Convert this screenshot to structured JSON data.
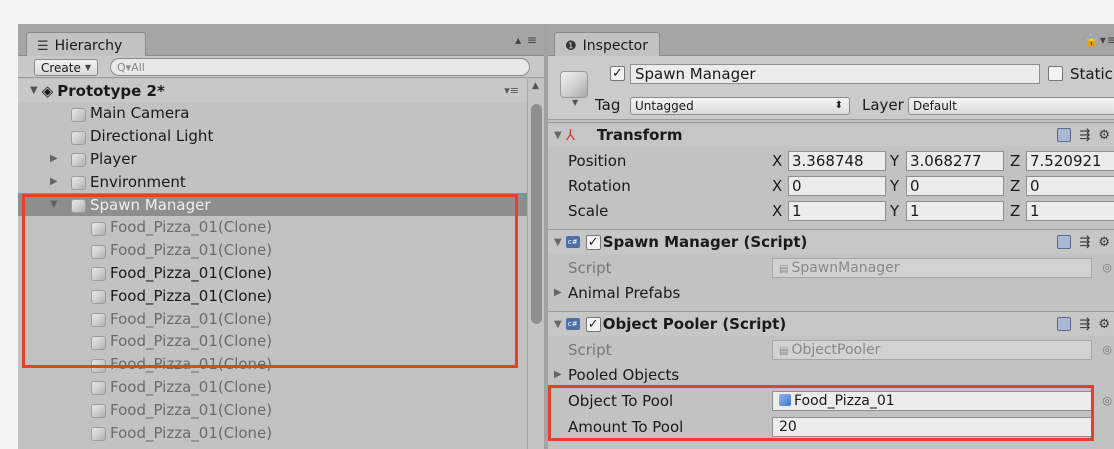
{
  "hierarchy": {
    "tab_label": "Hierarchy",
    "tab_icon": "list-icon",
    "tab_tools": "▴ ≡",
    "create_label": "Create",
    "search_placeholder": "Q▾All",
    "scene_name": "Prototype 2*",
    "items": [
      {
        "label": "Main Camera",
        "level": 1,
        "dim": false,
        "selected": false,
        "foldable": false
      },
      {
        "label": "Directional Light",
        "level": 1,
        "dim": false,
        "selected": false,
        "foldable": false
      },
      {
        "label": "Player",
        "level": 1,
        "dim": false,
        "selected": false,
        "foldable": true,
        "expanded": false
      },
      {
        "label": "Environment",
        "level": 1,
        "dim": false,
        "selected": false,
        "foldable": true,
        "expanded": false
      },
      {
        "label": "Spawn Manager",
        "level": 1,
        "dim": false,
        "selected": true,
        "foldable": true,
        "expanded": true
      },
      {
        "label": "Food_Pizza_01(Clone)",
        "level": 2,
        "dim": true,
        "selected": false
      },
      {
        "label": "Food_Pizza_01(Clone)",
        "level": 2,
        "dim": true,
        "selected": false
      },
      {
        "label": "Food_Pizza_01(Clone)",
        "level": 2,
        "dim": false,
        "selected": false
      },
      {
        "label": "Food_Pizza_01(Clone)",
        "level": 2,
        "dim": false,
        "selected": false
      },
      {
        "label": "Food_Pizza_01(Clone)",
        "level": 2,
        "dim": true,
        "selected": false
      },
      {
        "label": "Food_Pizza_01(Clone)",
        "level": 2,
        "dim": true,
        "selected": false
      },
      {
        "label": "Food_Pizza_01(Clone)",
        "level": 2,
        "dim": true,
        "selected": false
      },
      {
        "label": "Food_Pizza_01(Clone)",
        "level": 2,
        "dim": true,
        "selected": false
      },
      {
        "label": "Food_Pizza_01(Clone)",
        "level": 2,
        "dim": true,
        "selected": false
      },
      {
        "label": "Food_Pizza_01(Clone)",
        "level": 2,
        "dim": true,
        "selected": false
      }
    ]
  },
  "inspector": {
    "tab_label": "Inspector",
    "tab_icon": "info-icon",
    "object_name": "Spawn Manager",
    "static_label": "Static",
    "tag_label": "Tag",
    "tag_value": "Untagged",
    "layer_label": "Layer",
    "layer_value": "Default",
    "transform": {
      "title": "Transform",
      "position_label": "Position",
      "rotation_label": "Rotation",
      "scale_label": "Scale",
      "x": "X",
      "y": "Y",
      "z": "Z",
      "position": [
        "3.368748",
        "3.068277",
        "7.520921"
      ],
      "rotation": [
        "0",
        "0",
        "0"
      ],
      "scale": [
        "1",
        "1",
        "1"
      ]
    },
    "spawn_manager": {
      "title": "Spawn Manager (Script)",
      "script_label": "Script",
      "script_value": "SpawnManager",
      "animal_prefabs_label": "Animal Prefabs"
    },
    "object_pooler": {
      "title": "Object Pooler (Script)",
      "script_label": "Script",
      "script_value": "ObjectPooler",
      "pooled_objects_label": "Pooled Objects",
      "object_to_pool_label": "Object To Pool",
      "object_to_pool_value": "Food_Pizza_01",
      "amount_to_pool_label": "Amount To Pool",
      "amount_to_pool_value": "20"
    }
  },
  "highlight_color": "#e5402a"
}
